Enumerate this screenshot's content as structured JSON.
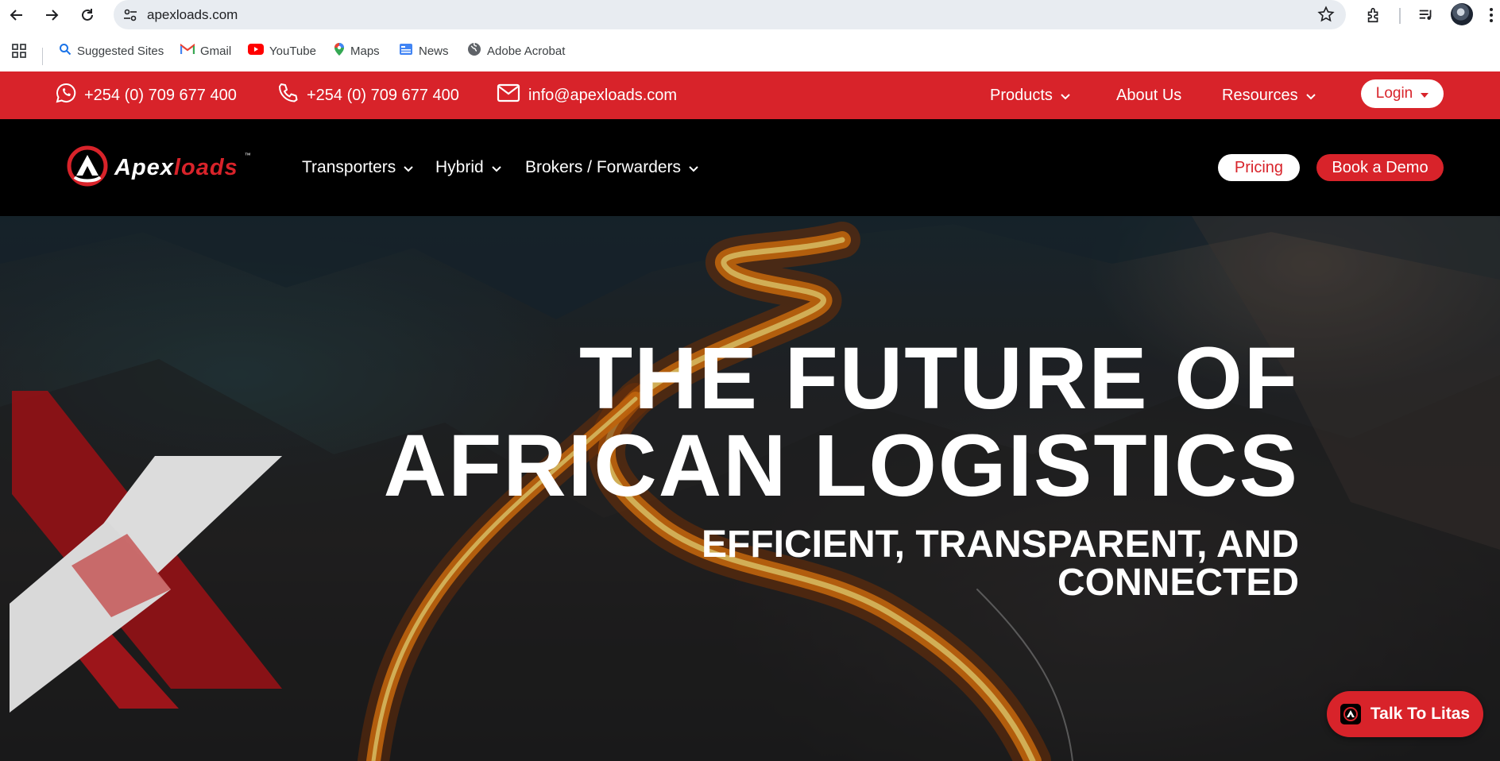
{
  "browser": {
    "url": "apexloads.com",
    "bookmarks": [
      "Suggested Sites",
      "Gmail",
      "YouTube",
      "Maps",
      "News",
      "Adobe Acrobat"
    ]
  },
  "topbar": {
    "whatsapp": "+254 (0) 709 677 400",
    "phone": "+254 (0) 709 677 400",
    "email": "info@apexloads.com",
    "nav": [
      "Products",
      "About Us",
      "Resources"
    ],
    "login": "Login"
  },
  "mainnav": {
    "logo_primary": "Apex",
    "logo_secondary": "loads",
    "logo_tm": "™",
    "items": [
      "Transporters",
      "Hybrid",
      "Brokers / Forwarders"
    ],
    "pricing": "Pricing",
    "demo": "Book a Demo"
  },
  "hero": {
    "line1": "THE FUTURE OF",
    "line2": "AFRICAN LOGISTICS",
    "sub1": "EFFICIENT, TRANSPARENT, AND",
    "sub2": "CONNECTED"
  },
  "chat": {
    "label": "Talk To Litas"
  },
  "colors": {
    "brand_red": "#d8232a",
    "nav_black": "#000000"
  }
}
